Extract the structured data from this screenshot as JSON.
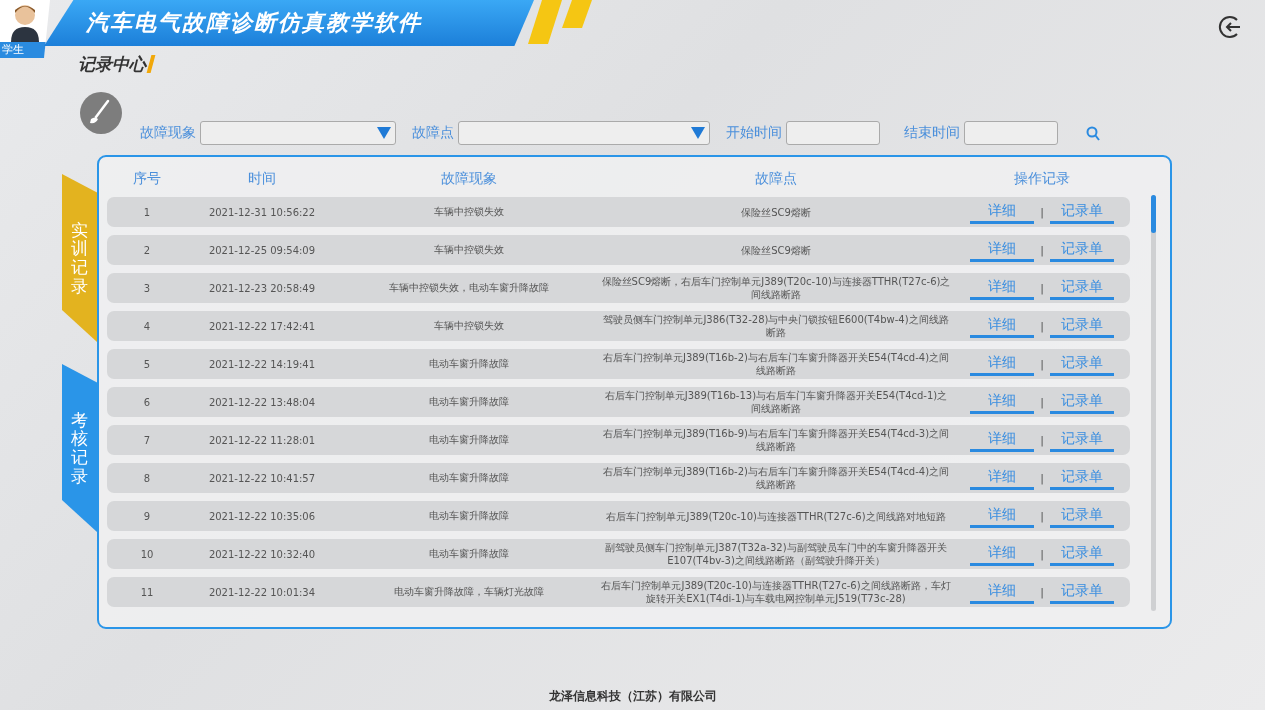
{
  "header": {
    "role": "学生",
    "title": "汽车电气故障诊断仿真教学软件"
  },
  "section_title": "记录中心",
  "filters": [
    {
      "kind": "dropdown",
      "label": "故障现象"
    },
    {
      "kind": "dropdown",
      "label": "故障点"
    },
    {
      "kind": "date",
      "label": "开始时间"
    },
    {
      "kind": "date",
      "label": "结束时间"
    }
  ],
  "side_tabs": [
    {
      "label": "实训记录",
      "selected": true
    },
    {
      "label": "考核记录",
      "selected": false
    }
  ],
  "table": {
    "columns": [
      "序号",
      "时间",
      "故障现象",
      "故障点",
      "操作记录"
    ],
    "rows": [
      {
        "index": "1",
        "time": "2021-12-31 10:56:22",
        "symptom": "车辆中控锁失效",
        "fault_point": "保险丝SC9熔断",
        "detail": "详细",
        "separator": "|",
        "record": "记录单"
      },
      {
        "index": "2",
        "time": "2021-12-25 09:54:09",
        "symptom": "车辆中控锁失效",
        "fault_point": "保险丝SC9熔断",
        "detail": "详细",
        "separator": "|",
        "record": "记录单"
      },
      {
        "index": "3",
        "time": "2021-12-23 20:58:49",
        "symptom": "车辆中控锁失效，电动车窗升降故障",
        "fault_point": "保险丝SC9熔断，右后车门控制单元J389(T20c-10)与连接器TTHR(T27c-6)之间线路断路",
        "detail": "详细",
        "separator": "|",
        "record": "记录单"
      },
      {
        "index": "4",
        "time": "2021-12-22 17:42:41",
        "symptom": "车辆中控锁失效",
        "fault_point": "驾驶员侧车门控制单元J386(T32-28)与中央门锁按钮E600(T4bw-4)之间线路断路",
        "detail": "详细",
        "separator": "|",
        "record": "记录单"
      },
      {
        "index": "5",
        "time": "2021-12-22 14:19:41",
        "symptom": "电动车窗升降故障",
        "fault_point": "右后车门控制单元J389(T16b-2)与右后车门车窗升降器开关E54(T4cd-4)之间线路断路",
        "detail": "详细",
        "separator": "|",
        "record": "记录单"
      },
      {
        "index": "6",
        "time": "2021-12-22 13:48:04",
        "symptom": "电动车窗升降故障",
        "fault_point": "右后车门控制单元J389(T16b-13)与右后车门车窗升降器开关E54(T4cd-1)之间线路断路",
        "detail": "详细",
        "separator": "|",
        "record": "记录单"
      },
      {
        "index": "7",
        "time": "2021-12-22 11:28:01",
        "symptom": "电动车窗升降故障",
        "fault_point": "右后车门控制单元J389(T16b-9)与右后车门车窗升降器开关E54(T4cd-3)之间线路断路",
        "detail": "详细",
        "separator": "|",
        "record": "记录单"
      },
      {
        "index": "8",
        "time": "2021-12-22 10:41:57",
        "symptom": "电动车窗升降故障",
        "fault_point": "右后车门控制单元J389(T16b-2)与右后车门车窗升降器开关E54(T4cd-4)之间线路断路",
        "detail": "详细",
        "separator": "|",
        "record": "记录单"
      },
      {
        "index": "9",
        "time": "2021-12-22 10:35:06",
        "symptom": "电动车窗升降故障",
        "fault_point": "右后车门控制单元J389(T20c-10)与连接器TTHR(T27c-6)之间线路对地短路",
        "detail": "详细",
        "separator": "|",
        "record": "记录单"
      },
      {
        "index": "10",
        "time": "2021-12-22 10:32:40",
        "symptom": "电动车窗升降故障",
        "fault_point": "副驾驶员侧车门控制单元J387(T32a-32)与副驾驶员车门中的车窗升降器开关E107(T4bv-3)之间线路断路（副驾驶升降开关）",
        "detail": "详细",
        "separator": "|",
        "record": "记录单"
      },
      {
        "index": "11",
        "time": "2021-12-22 10:01:34",
        "symptom": "电动车窗升降故障，车辆灯光故障",
        "fault_point": "右后车门控制单元J389(T20c-10)与连接器TTHR(T27c-6)之间线路断路，车灯旋转开关EX1(T4di-1)与车载电网控制单元J519(T73c-28)",
        "detail": "详细",
        "separator": "|",
        "record": "记录单"
      }
    ]
  },
  "footer": "龙泽信息科技（江苏）有限公司"
}
